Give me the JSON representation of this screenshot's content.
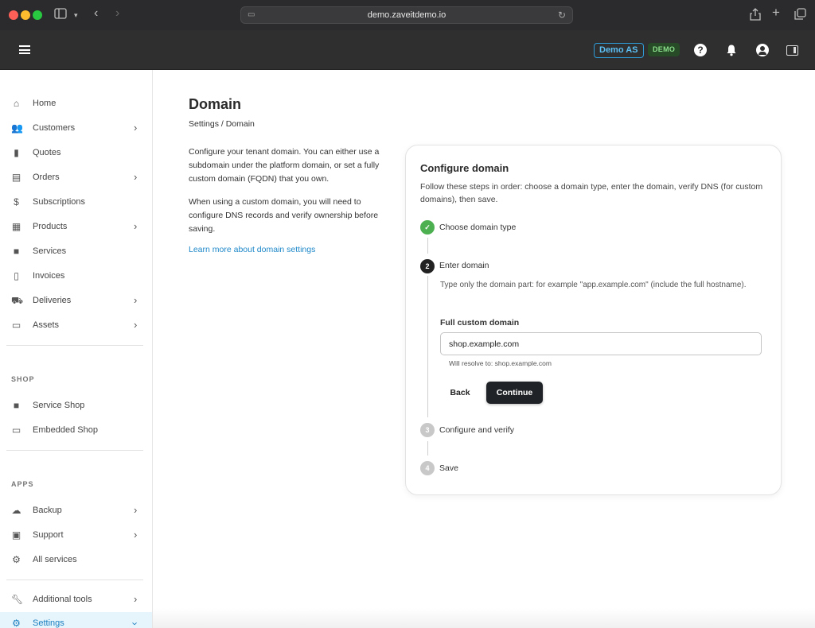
{
  "browser": {
    "url": "demo.zaveitdemo.io"
  },
  "header": {
    "tenant_badge": "Demo AS",
    "env_badge": "DEMO",
    "help_glyph": "?"
  },
  "sidebar": {
    "items": [
      {
        "label": "Home",
        "icon": "home-icon",
        "has_chevron": false
      },
      {
        "label": "Customers",
        "icon": "people-icon",
        "has_chevron": true
      },
      {
        "label": "Quotes",
        "icon": "document-dollar-icon",
        "has_chevron": false
      },
      {
        "label": "Orders",
        "icon": "list-icon",
        "has_chevron": true
      },
      {
        "label": "Subscriptions",
        "icon": "dollar-cycle-icon",
        "has_chevron": false
      },
      {
        "label": "Products",
        "icon": "catalog-icon",
        "has_chevron": true
      },
      {
        "label": "Services",
        "icon": "bag-icon",
        "has_chevron": false
      },
      {
        "label": "Invoices",
        "icon": "receipt-icon",
        "has_chevron": false
      },
      {
        "label": "Deliveries",
        "icon": "truck-icon",
        "has_chevron": true
      },
      {
        "label": "Assets",
        "icon": "laptop-icon",
        "has_chevron": true
      }
    ],
    "shop_section": "SHOP",
    "shop_items": [
      {
        "label": "Service Shop",
        "icon": "bag-icon"
      },
      {
        "label": "Embedded Shop",
        "icon": "embed-icon"
      }
    ],
    "apps_section": "APPS",
    "apps_items": [
      {
        "label": "Backup",
        "icon": "cloud-icon",
        "has_chevron": true
      },
      {
        "label": "Support",
        "icon": "ticket-icon",
        "has_chevron": true
      },
      {
        "label": "All services",
        "icon": "gears-icon",
        "has_chevron": false
      }
    ],
    "tools_item": {
      "label": "Additional tools",
      "icon": "wrench-icon"
    },
    "settings_item": {
      "label": "Settings",
      "icon": "gear-icon"
    }
  },
  "main": {
    "title": "Domain",
    "breadcrumb": "Settings / Domain",
    "intro_p1": "Configure your tenant domain. You can either use a subdomain under the platform domain, or set a fully custom domain (FQDN) that you own.",
    "intro_p2": "When using a custom domain, you will need to configure DNS records and verify ownership before saving.",
    "learn_link": "Learn more about domain settings"
  },
  "card": {
    "title": "Configure domain",
    "description": "Follow these steps in order: choose a domain type, enter the domain, verify DNS (for custom domains), then save.",
    "steps": [
      {
        "number": "✓",
        "label": "Choose domain type",
        "state": "done"
      },
      {
        "number": "2",
        "label": "Enter domain",
        "state": "current"
      },
      {
        "number": "3",
        "label": "Configure and verify",
        "state": "pending"
      },
      {
        "number": "4",
        "label": "Save",
        "state": "pending"
      }
    ],
    "hint": "Type only the domain part: for example \"app.example.com\" (include the full hostname).",
    "field_label": "Full custom domain",
    "field_value": "shop.example.com",
    "helper": "Will resolve to: shop.example.com",
    "back_label": "Back",
    "continue_label": "Continue"
  },
  "colors": {
    "accent": "#1a7fc1",
    "step_done": "#4caf50",
    "primary_button": "#1f2226"
  }
}
